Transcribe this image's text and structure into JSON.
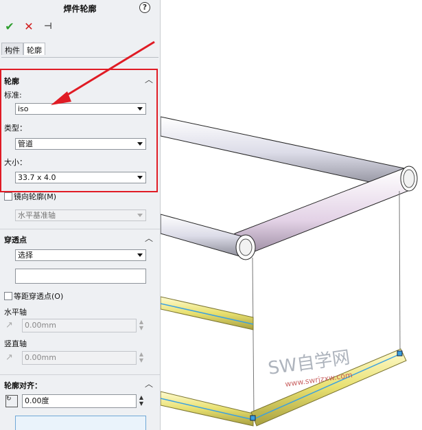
{
  "panel": {
    "title": "焊件轮廓",
    "help": "?",
    "actions": {
      "ok": "✔",
      "cancel": "✕",
      "pin": "⊣"
    },
    "tabs": [
      "构件",
      "轮廓"
    ],
    "profile_section": {
      "title": "轮廓",
      "standard_label": "标准:",
      "standard_value": "iso",
      "type_label": "类型：",
      "type_value": "管道",
      "size_label": "大小：",
      "size_value": "33.7 x 4.0"
    },
    "mirror_label": "镜向轮廓(M)",
    "mirror_axis_value": "水平基准轴",
    "pierce_section": {
      "title": "穿透点",
      "select_value": "选择",
      "equal_label": "等距穿透点(O)",
      "horizontal_label": "水平轴",
      "horizontal_value": "0.00mm",
      "vertical_label": "竖直轴",
      "vertical_value": "0.00mm"
    },
    "align_section": {
      "title": "轮廓对齐：",
      "angle_value": "0.00度"
    }
  },
  "watermark": {
    "text": "SW自学网",
    "url": "www.swrjzxw.com"
  },
  "colors": {
    "highlight": "#e01b24",
    "ok": "#2e9e2e",
    "cancel": "#d11a1a",
    "tube_yellow": "#e8e070",
    "edge_blue": "#3aa0e0"
  }
}
